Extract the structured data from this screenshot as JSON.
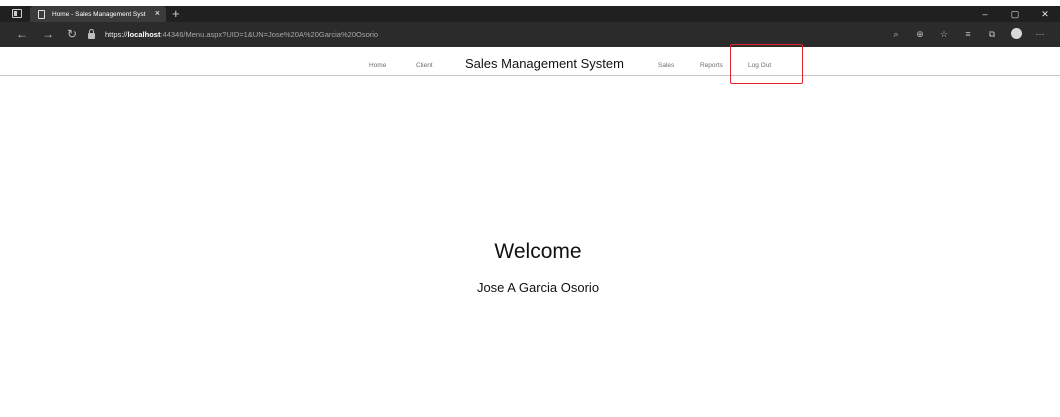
{
  "browser": {
    "tab_title": "Home - Sales Management Syst",
    "tab_close": "×",
    "new_tab": "+",
    "url_scheme": "https://",
    "url_host": "localhost",
    "url_rest": ":44346/Menu.aspx?UID=1&UN=Jose%20A%20Garcia%20Osorio",
    "window_controls": [
      "–",
      "▢",
      "✕"
    ],
    "toolbar_icons": [
      "read-aloud-icon",
      "zoom-icon",
      "favorite-icon",
      "favorites-list-icon",
      "collections-icon",
      "profile-avatar",
      "more-icon"
    ]
  },
  "nav": {
    "home": "Home",
    "client": "Client",
    "brand": "Sales Management System",
    "sales": "Sales",
    "reports": "Reports",
    "logout": "Log Out"
  },
  "main": {
    "welcome": "Welcome",
    "user_name": "Jose A Garcia Osorio"
  },
  "colors": {
    "browser_dark": "#202020",
    "address_bar": "#2b2b2b",
    "highlight_red": "#e0262e"
  }
}
